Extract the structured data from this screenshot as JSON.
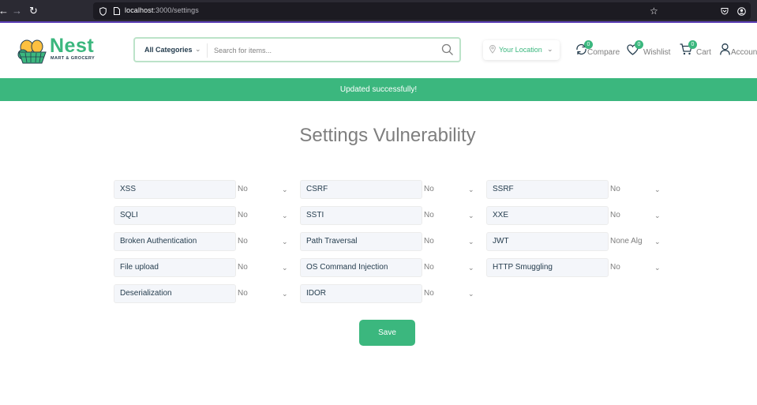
{
  "browser": {
    "url_host": "localhost",
    "url_path": ":3000/settings"
  },
  "header": {
    "logo_title": "Nest",
    "logo_subtitle": "MART & GROCERY",
    "category_label": "All Categories",
    "search_placeholder": "Search for items...",
    "location_label": "Your Location",
    "actions": [
      {
        "label": "Compare",
        "badge": "0"
      },
      {
        "label": "Wishlist",
        "badge": "0"
      },
      {
        "label": "Cart",
        "badge": "0"
      },
      {
        "label": "Account"
      }
    ]
  },
  "alert": {
    "message": "Updated successfully!"
  },
  "page_title": "Settings Vulnerability",
  "settings": [
    {
      "name": "XSS",
      "value": "No"
    },
    {
      "name": "CSRF",
      "value": "No"
    },
    {
      "name": "SSRF",
      "value": "No"
    },
    {
      "name": "SQLI",
      "value": "No"
    },
    {
      "name": "SSTI",
      "value": "No"
    },
    {
      "name": "XXE",
      "value": "No"
    },
    {
      "name": "Broken Authentication",
      "value": "No"
    },
    {
      "name": "Path Traversal",
      "value": "No"
    },
    {
      "name": "JWT",
      "value": "None Alg"
    },
    {
      "name": "File upload",
      "value": "No"
    },
    {
      "name": "OS Command Injection",
      "value": "No"
    },
    {
      "name": "HTTP Smuggling",
      "value": "No"
    },
    {
      "name": "Deserialization",
      "value": "No"
    },
    {
      "name": "IDOR",
      "value": "No"
    }
  ],
  "save_label": "Save",
  "colors": {
    "brand": "#3bb77e",
    "text": "#253d4e",
    "muted": "#7e7e7e"
  },
  "icons": [
    "back-icon",
    "forward-icon",
    "reload-icon",
    "shield-icon",
    "page-icon",
    "star-icon",
    "pocket-icon",
    "profile-icon",
    "search-icon",
    "location-pin-icon",
    "chevron-down-icon",
    "compare-icon",
    "heart-icon",
    "cart-icon",
    "user-icon"
  ]
}
